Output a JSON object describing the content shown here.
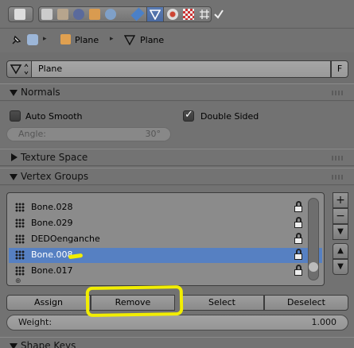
{
  "toolbar": {
    "buttons": [
      "editor-type-button",
      "render-button",
      "scene-button",
      "world-button",
      "object-button",
      "constraints-button",
      "modifiers-button",
      "data-button",
      "material-button",
      "texture-button",
      "physics-button"
    ],
    "active": "data-button"
  },
  "breadcrumb": {
    "items": [
      "Plane",
      "Plane"
    ]
  },
  "datablock": {
    "name": "Plane",
    "fake_user": "F"
  },
  "normals": {
    "title": "Normals",
    "auto_smooth": "Auto Smooth",
    "auto_smooth_checked": false,
    "double_sided": "Double Sided",
    "double_sided_checked": true,
    "angle_label": "Angle:",
    "angle_value": "30°"
  },
  "texture_space": {
    "title": "Texture Space"
  },
  "vertex_groups": {
    "title": "Vertex Groups",
    "groups": [
      {
        "name": "Bone.028",
        "selected": false
      },
      {
        "name": "Bone.029",
        "selected": false
      },
      {
        "name": "DEDOenganche",
        "selected": false
      },
      {
        "name": "Bone.008",
        "selected": true
      },
      {
        "name": "Bone.017",
        "selected": false
      }
    ],
    "side_buttons": [
      "+",
      "−",
      "▼",
      "▲",
      "▼"
    ],
    "actions": {
      "assign": "Assign",
      "remove": "Remove",
      "select": "Select",
      "deselect": "Deselect"
    },
    "weight_label": "Weight:",
    "weight_value": "1.000"
  },
  "shape_keys": {
    "title": "Shape Keys"
  },
  "colors": {
    "selection": "#5680c2",
    "highlight_annotation": "#f2ee00"
  }
}
